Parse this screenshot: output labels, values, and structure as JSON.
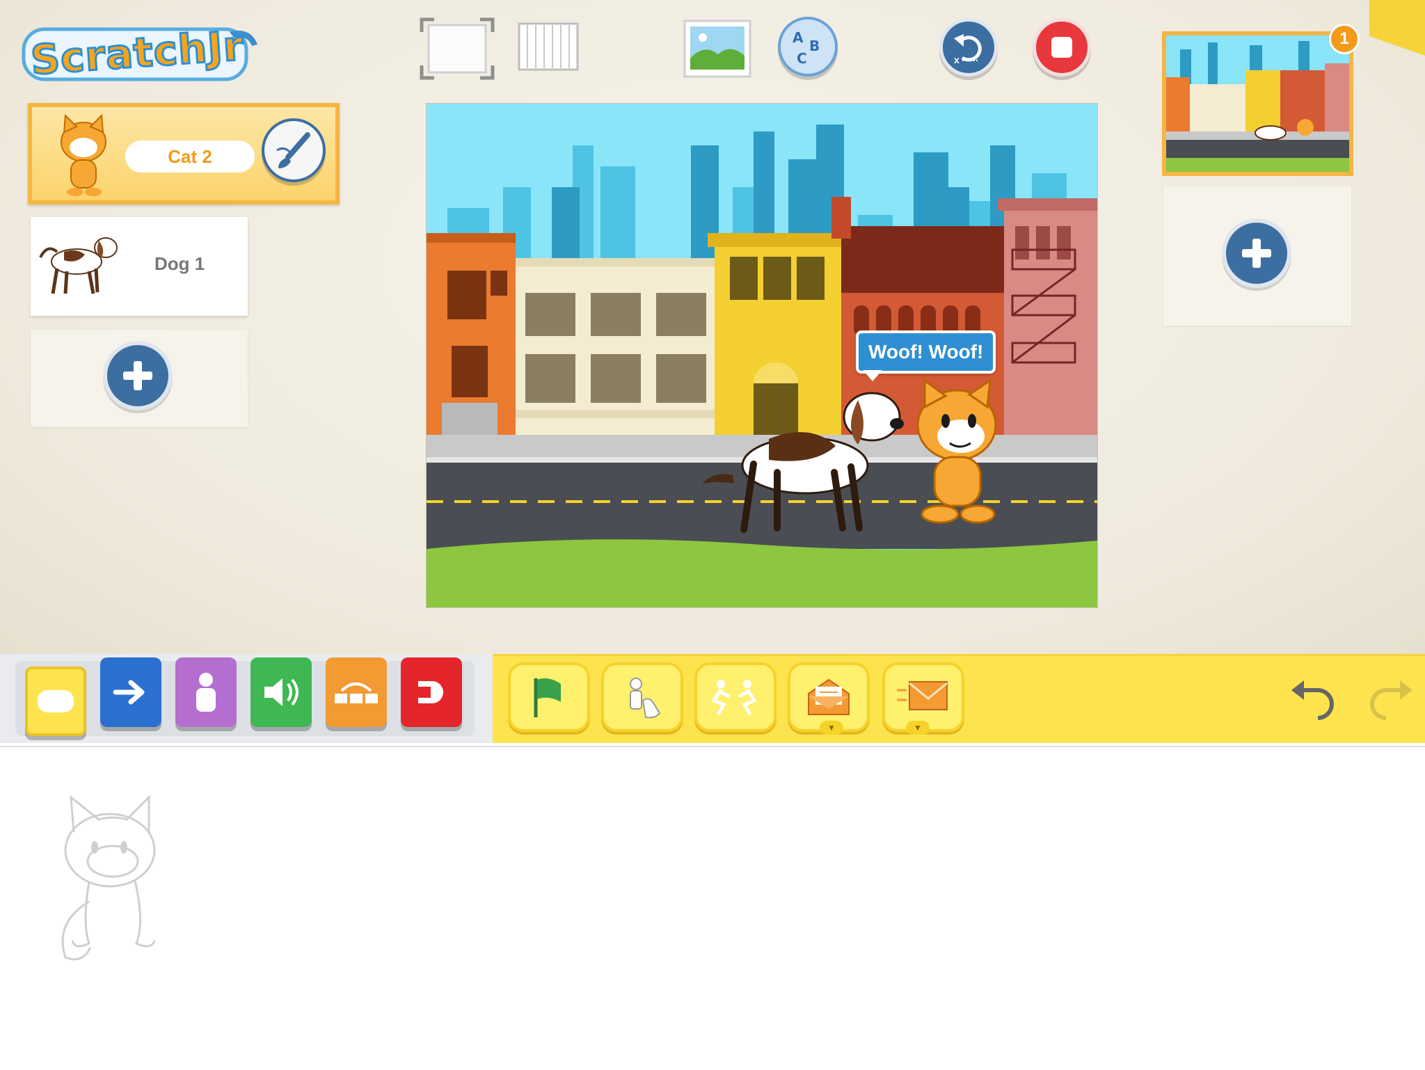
{
  "app": {
    "logo_text": "ScratchJr"
  },
  "toolbar": {
    "fullscreen_icon": "fullscreen-icon",
    "grid_icon": "grid-icon",
    "background_icon": "background-picture-icon",
    "text_icon": "abc-text-icon",
    "reset_icon": "reset-characters-icon",
    "stop_icon": "stop-icon"
  },
  "sprites": {
    "items": [
      {
        "name": "Cat 2",
        "selected": true
      },
      {
        "name": "Dog 1",
        "selected": false
      }
    ],
    "add_icon": "plus-icon",
    "paint_icon": "paintbrush-icon"
  },
  "stage": {
    "speech_text": "Woof! Woof!"
  },
  "pages": {
    "badge": "1",
    "add_icon": "plus-icon"
  },
  "palette": {
    "categories": [
      "triggering",
      "motion",
      "looks",
      "sound",
      "control",
      "end"
    ],
    "blocks": [
      "start-on-green-flag",
      "start-on-tap",
      "start-on-bump",
      "start-on-message",
      "send-message"
    ]
  },
  "colors": {
    "accent_orange": "#f5b544",
    "blue_button": "#3c6ea2",
    "stop_red": "#e8383d",
    "palette_yellow": "#fde44f"
  }
}
